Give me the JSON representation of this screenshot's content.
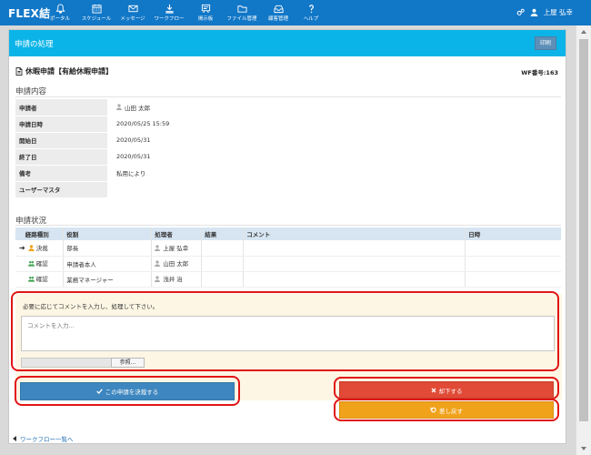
{
  "app": {
    "brand": "FLEX結"
  },
  "nav": [
    {
      "label": "ポータル",
      "icon": "bell-icon"
    },
    {
      "label": "スケジュール",
      "icon": "calendar-icon"
    },
    {
      "label": "メッセージ",
      "icon": "envelope-icon"
    },
    {
      "label": "ワークフロー",
      "icon": "workflow-icon"
    },
    {
      "label": "掲示板",
      "icon": "board-icon"
    },
    {
      "label": "ファイル管理",
      "icon": "folder-icon"
    },
    {
      "label": "顧客管理",
      "icon": "customer-icon"
    },
    {
      "label": "ヘルプ",
      "icon": "help-icon"
    }
  ],
  "user": {
    "name": "上屋 弘幸",
    "settings_icon": "gears-icon",
    "avatar_icon": "user-icon"
  },
  "panel": {
    "title": "申請の処理",
    "print_label": "印刷"
  },
  "document": {
    "title": "休暇申請【有給休暇申請】",
    "wf_no": "WF番号:163"
  },
  "details": {
    "heading": "申請内容",
    "rows": [
      {
        "key": "申請者",
        "value": "山田 太郎",
        "person": true
      },
      {
        "key": "申請日時",
        "value": "2020/05/25 15:59"
      },
      {
        "key": "開始日",
        "value": "2020/05/31"
      },
      {
        "key": "終了日",
        "value": "2020/05/31"
      },
      {
        "key": "備考",
        "value": "私用により"
      },
      {
        "key": "ユーザーマスタ",
        "value": ""
      }
    ]
  },
  "route": {
    "heading": "申請状況",
    "columns": [
      "経路種別",
      "役割",
      "処理者",
      "結果",
      "コメント",
      "日時"
    ],
    "rows": [
      {
        "current": true,
        "type": "決裁",
        "role": "部長",
        "processor": "上屋 弘幸",
        "result": "",
        "comment": "",
        "datetime": ""
      },
      {
        "current": false,
        "type": "確認",
        "role": "申請者本人",
        "processor": "山田 太郎",
        "result": "",
        "comment": "",
        "datetime": ""
      },
      {
        "current": false,
        "type": "確認",
        "role": "業務マネージャー",
        "processor": "浅井 治",
        "result": "",
        "comment": "",
        "datetime": ""
      }
    ],
    "current_marker": "➔"
  },
  "comment": {
    "hint": "必要に応じてコメントを入力し、処理して下さい。",
    "placeholder": "コメントを入力...",
    "browse_label": "参照..."
  },
  "actions": {
    "approve_label": "この申請を決裁する",
    "reject_label": "却下する",
    "return_label": "差し戻す"
  },
  "back_link": "ワークフロー一覧へ",
  "colors": {
    "topbar": "#1177c7",
    "panel_head": "#0bb4e8",
    "approve": "#3d86bf",
    "reject": "#e04a36",
    "return": "#f0a21b",
    "highlight": "#e11515"
  }
}
